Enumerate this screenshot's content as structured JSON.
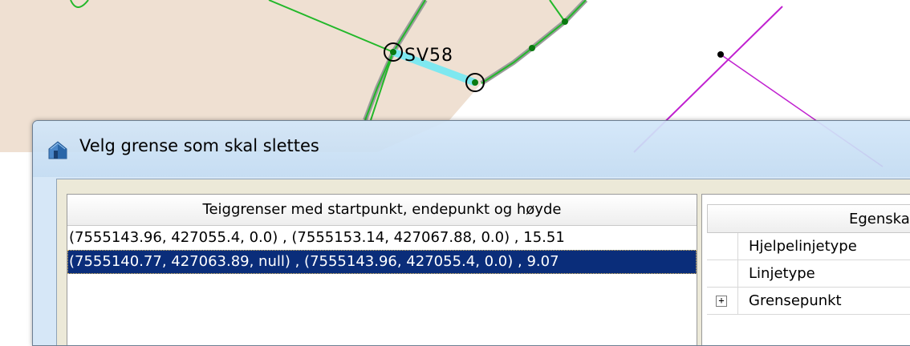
{
  "map": {
    "point_label": "SV58"
  },
  "dialog": {
    "title": "Velg grense som skal slettes",
    "icon": "house-icon",
    "list": {
      "header": "Teiggrenser med startpunkt, endepunkt og høyde",
      "rows": [
        "(7555143.96, 427055.4, 0.0) , (7555153.14, 427067.88, 0.0) , 15.51",
        "(7555140.77, 427063.89, null) , (7555143.96, 427055.4, 0.0) , 9.07"
      ],
      "selected_index": 1
    },
    "properties": {
      "header": "Egenska",
      "rows": [
        {
          "label": "Hjelpelinjetype",
          "expandable": false
        },
        {
          "label": "Linjetype",
          "expandable": false
        },
        {
          "label": "Grensepunkt",
          "expandable": true,
          "expander_symbol": "+"
        }
      ]
    }
  },
  "colors": {
    "selection": "#0a2d7a",
    "map_fill": "#efe0d2",
    "line_green": "#23b82a",
    "line_magenta": "#c020d0",
    "highlight_cyan": "#7ee8f0"
  }
}
